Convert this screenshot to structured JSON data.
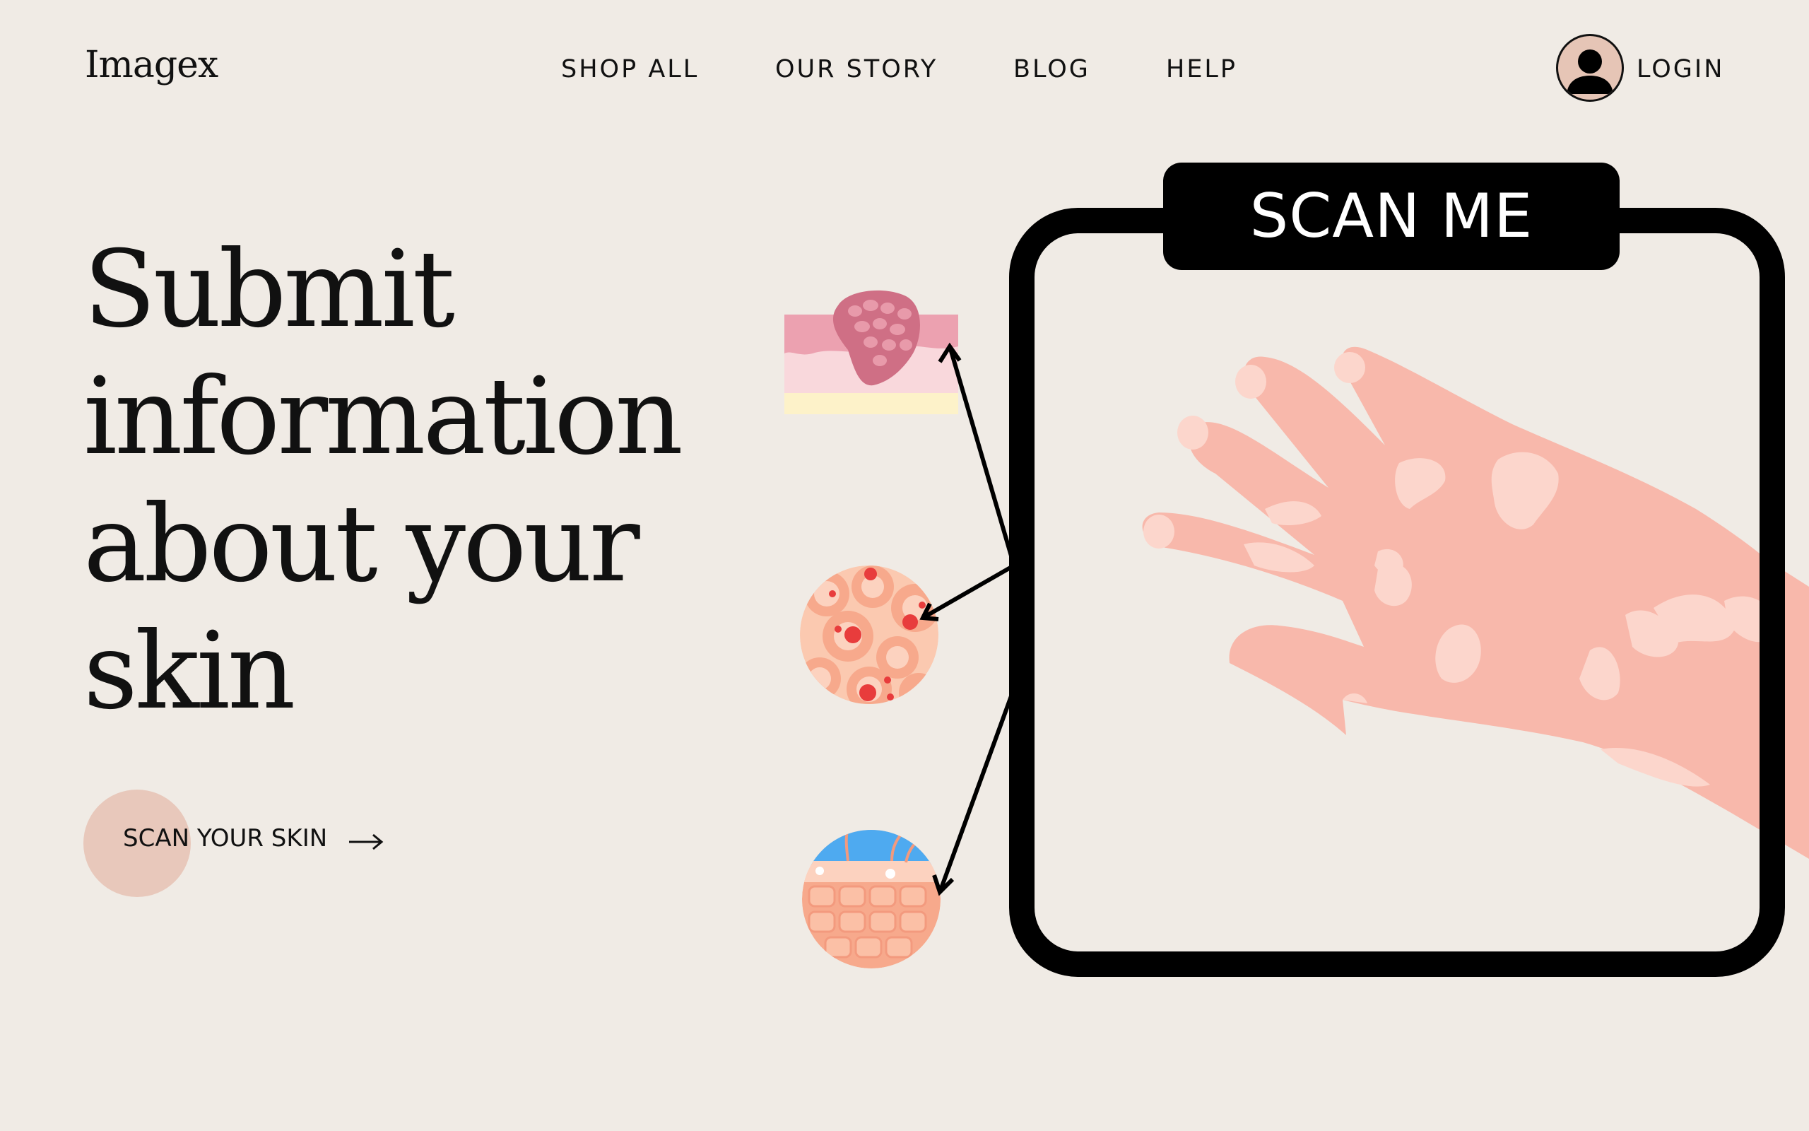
{
  "brand": {
    "logo": "Imagex"
  },
  "nav": {
    "items": [
      {
        "label": "SHOP ALL"
      },
      {
        "label": "OUR STORY"
      },
      {
        "label": "BLOG"
      },
      {
        "label": "HELP"
      }
    ],
    "login_label": "LOGIN",
    "avatar_icon": "user-avatar-icon"
  },
  "hero": {
    "line1": "Submit",
    "line2": "information",
    "line3": "about your",
    "line4": "skin",
    "cta_label": "SCAN YOUR SKIN",
    "cta_icon": "arrow-right-icon"
  },
  "scanner": {
    "label": "SCAN ME"
  },
  "colors": {
    "background": "#f0ebe5",
    "cta_circle": "#e8c8bb",
    "skin": "#f8b8ab",
    "skin_patch": "#fcd6cc",
    "frame": "#000000"
  }
}
